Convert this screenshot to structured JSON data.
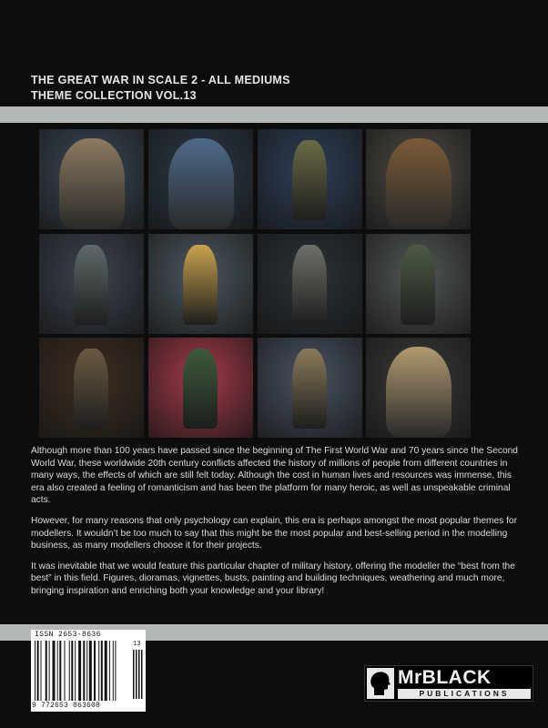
{
  "title": {
    "line1": "THE GREAT WAR IN SCALE 2 - ALL MEDIUMS",
    "line2": "THEME COLLECTION VOL.13"
  },
  "photos": [
    {
      "name": "photo-bust-officer-grey",
      "bg": "#3b4a58",
      "fig": "#8e7a62"
    },
    {
      "name": "photo-bust-brodie-helmet",
      "bg": "#2c3a48",
      "fig": "#4d6a8a"
    },
    {
      "name": "photo-figure-officer-pointing",
      "bg": "#2f3f58",
      "fig": "#6b6a46"
    },
    {
      "name": "photo-bust-fur-hat",
      "bg": "#4e4a44",
      "fig": "#7a5a38"
    },
    {
      "name": "photo-figure-officer-greatcoat",
      "bg": "#3c4350",
      "fig": "#5f6a6a"
    },
    {
      "name": "photo-figure-yellow-coat",
      "bg": "#4c5860",
      "fig": "#c9a24e"
    },
    {
      "name": "photo-figure-rifleman-stump",
      "bg": "#2b3238",
      "fig": "#6e7068"
    },
    {
      "name": "photo-diorama-soldiers-group",
      "bg": "#545858",
      "fig": "#4c5a44"
    },
    {
      "name": "photo-diorama-trench-wreck",
      "bg": "#3e2e22",
      "fig": "#6a5a42"
    },
    {
      "name": "photo-figure-green-soldier-red",
      "bg": "#a53a4a",
      "fig": "#3d5a3a"
    },
    {
      "name": "photo-figure-trench-coat",
      "bg": "#4a5464",
      "fig": "#8a7a5a"
    },
    {
      "name": "photo-bust-mustache-officer",
      "bg": "#3a3a38",
      "fig": "#b09a70"
    }
  ],
  "body": {
    "p1": "Although more than 100 years have passed since the beginning of The First World War and 70 years since the Second World War, these worldwide 20th century conflicts affected the history of millions of people from different countries in many ways, the effects of which are still felt today. Although the cost in human lives and resources was immense, this era also created a feeling of romanticism and has been the platform for many heroic, as well as unspeakable criminal acts.",
    "p2": "However, for many reasons that only psychology can explain, this era is perhaps amongst the most popular themes for modellers. It wouldn’t be too much to say that this might be the most popular and best-selling period in the modelling business, as many modellers choose it for their projects.",
    "p3": "It was inevitable that we would feature this particular chapter of military history, offering the modeller the “best from the best” in this field. Figures, dioramas, vignettes, busts, painting and building techniques, weathering and much more, bringing inspiration and enriching both your knowledge and your library!"
  },
  "barcode": {
    "issn": "ISSN 2653-8636",
    "number": "9 772653 863608",
    "addon": "13"
  },
  "logo": {
    "brand": "MrBLACK",
    "sub": "PUBLICATIONS"
  }
}
